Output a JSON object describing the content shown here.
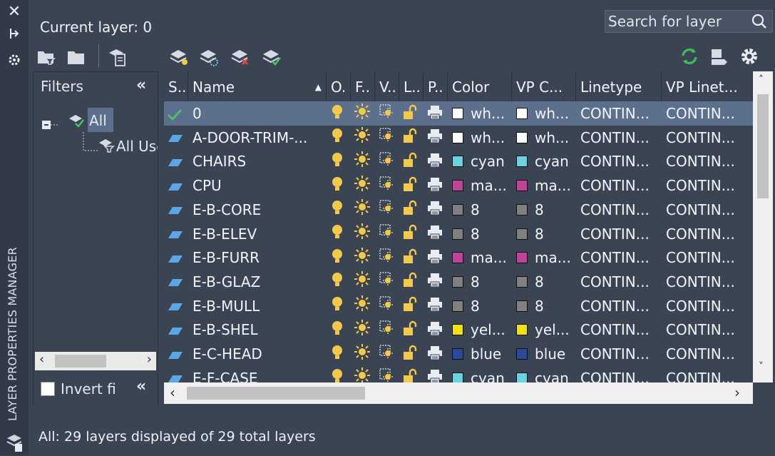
{
  "panel": {
    "vertical_title": "LAYER PROPERTIES MANAGER",
    "current_layer": "Current layer: 0",
    "search_placeholder": "Search for layer",
    "status": "All: 29 layers displayed of 29 total layers"
  },
  "filters": {
    "header": "Filters",
    "tree": [
      "All",
      "All Use"
    ],
    "invert_label": "Invert fi"
  },
  "columns": [
    "S..",
    "Name",
    "O.",
    "F..",
    "V..",
    "L..",
    "P..",
    "Color",
    "VP C...",
    "Linetype",
    "VP Linet..."
  ],
  "icons": {
    "on": "lightbulb-icon",
    "freeze": "sun-icon",
    "vp_freeze": "viewport-freeze-icon",
    "lock": "padlock-open-icon",
    "plot": "printer-icon"
  },
  "layers": [
    {
      "status": "current",
      "name": "0",
      "color": "wh...",
      "color_hex": "#ffffff",
      "vp_color": "wh...",
      "vp_color_hex": "#ffffff",
      "linetype": "CONTIN...",
      "vp_linetype": "CONTIN..."
    },
    {
      "status": "layer",
      "name": "A-DOOR-TRIM-...",
      "color": "wh...",
      "color_hex": "#ffffff",
      "vp_color": "wh...",
      "vp_color_hex": "#ffffff",
      "linetype": "CONTIN...",
      "vp_linetype": "CONTIN..."
    },
    {
      "status": "layer",
      "name": "CHAIRS",
      "color": "cyan",
      "color_hex": "#6ad3e2",
      "vp_color": "cyan",
      "vp_color_hex": "#6ad3e2",
      "linetype": "CONTIN...",
      "vp_linetype": "CONTIN..."
    },
    {
      "status": "layer",
      "name": "CPU",
      "color": "ma...",
      "color_hex": "#c0459a",
      "vp_color": "ma...",
      "vp_color_hex": "#c0459a",
      "linetype": "CONTIN...",
      "vp_linetype": "CONTIN..."
    },
    {
      "status": "layer",
      "name": "E-B-CORE",
      "color": "8",
      "color_hex": "#808080",
      "vp_color": "8",
      "vp_color_hex": "#808080",
      "linetype": "CONTIN...",
      "vp_linetype": "CONTIN..."
    },
    {
      "status": "layer",
      "name": "E-B-ELEV",
      "color": "8",
      "color_hex": "#808080",
      "vp_color": "8",
      "vp_color_hex": "#808080",
      "linetype": "CONTIN...",
      "vp_linetype": "CONTIN..."
    },
    {
      "status": "layer",
      "name": "E-B-FURR",
      "color": "ma...",
      "color_hex": "#c0459a",
      "vp_color": "ma...",
      "vp_color_hex": "#c0459a",
      "linetype": "CONTIN...",
      "vp_linetype": "CONTIN..."
    },
    {
      "status": "layer",
      "name": "E-B-GLAZ",
      "color": "8",
      "color_hex": "#808080",
      "vp_color": "8",
      "vp_color_hex": "#808080",
      "linetype": "CONTIN...",
      "vp_linetype": "CONTIN..."
    },
    {
      "status": "layer",
      "name": "E-B-MULL",
      "color": "8",
      "color_hex": "#808080",
      "vp_color": "8",
      "vp_color_hex": "#808080",
      "linetype": "CONTIN...",
      "vp_linetype": "CONTIN..."
    },
    {
      "status": "layer",
      "name": "E-B-SHEL",
      "color": "yel...",
      "color_hex": "#f0e010",
      "vp_color": "yel...",
      "vp_color_hex": "#f0e010",
      "linetype": "CONTIN...",
      "vp_linetype": "CONTIN..."
    },
    {
      "status": "layer",
      "name": "E-C-HEAD",
      "color": "blue",
      "color_hex": "#2a4aa0",
      "vp_color": "blue",
      "vp_color_hex": "#2a4aa0",
      "linetype": "CONTIN...",
      "vp_linetype": "CONTIN..."
    },
    {
      "status": "layer",
      "name": "E-F-CASE",
      "color": "cyan",
      "color_hex": "#6ad3e2",
      "vp_color": "cyan",
      "vp_color_hex": "#6ad3e2",
      "linetype": "CONTIN...",
      "vp_linetype": "CONTIN..."
    }
  ]
}
